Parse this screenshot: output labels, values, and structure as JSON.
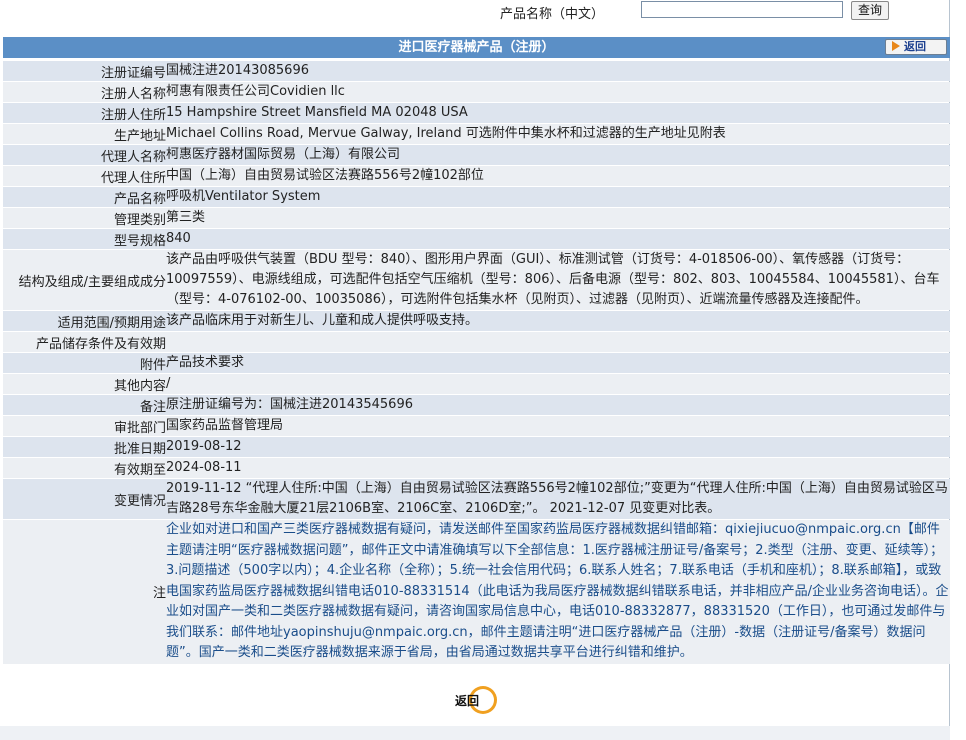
{
  "search": {
    "label": "产品名称（中文）",
    "value": "",
    "button": "查询"
  },
  "header": {
    "title": "进口医疗器械产品（注册）",
    "back_label": "返回"
  },
  "rows": [
    {
      "label": "注册证编号",
      "value": "国械注进20143085696"
    },
    {
      "label": "注册人名称",
      "value": "柯惠有限责任公司Covidien llc"
    },
    {
      "label": "注册人住所",
      "value": "15 Hampshire Street Mansfield MA 02048 USA"
    },
    {
      "label": "生产地址",
      "value": "Michael Collins Road, Mervue Galway, Ireland 可选附件中集水杯和过滤器的生产地址见附表"
    },
    {
      "label": "代理人名称",
      "value": "柯惠医疗器材国际贸易（上海）有限公司"
    },
    {
      "label": "代理人住所",
      "value": "中国（上海）自由贸易试验区法赛路556号2幢102部位"
    },
    {
      "label": "产品名称",
      "value": "呼吸机Ventilator System"
    },
    {
      "label": "管理类别",
      "value": "第三类"
    },
    {
      "label": "型号规格",
      "value": "840"
    },
    {
      "label": "结构及组成/主要组成成分",
      "value": "该产品由呼吸供气装置（BDU 型号：840）、图形用户界面（GUI）、标准测试管（订货号：4-018506-00）、氧传感器（订货号：10097559）、电源线组成，可选配件包括空气压缩机（型号：806）、后备电源（型号：802、803、10045584、10045581）、台车（型号：4-076102-00、10035086），可选附件包括集水杯（见附页）、过滤器（见附页）、近端流量传感器及连接配件。"
    },
    {
      "label": "适用范围/预期用途",
      "value": "该产品临床用于对新生儿、儿童和成人提供呼吸支持。"
    },
    {
      "label": "产品储存条件及有效期",
      "value": ""
    },
    {
      "label": "附件",
      "value": "产品技术要求"
    },
    {
      "label": "其他内容",
      "value": "/"
    },
    {
      "label": "备注",
      "value": "原注册证编号为：国械注进20143545696"
    },
    {
      "label": "审批部门",
      "value": "国家药品监督管理局"
    },
    {
      "label": "批准日期",
      "value": "2019-08-12"
    },
    {
      "label": "有效期至",
      "value": "2024-08-11"
    },
    {
      "label": "变更情况",
      "value": "2019-11-12 “代理人住所:中国（上海）自由贸易试验区法赛路556号2幢102部位;”变更为“代理人住所:中国（上海）自由贸易试验区马吉路28号东华金融大厦21层2106B室、2106C室、2106D室;”。 2021-12-07 见变更对比表。"
    },
    {
      "label": "注",
      "value": "企业如对进口和国产三类医疗器械数据有疑问，请发送邮件至国家药监局医疗器械数据纠错邮箱：qixiejiucuo@nmpaic.org.cn【邮件主题请注明“医疗器械数据问题”，邮件正文中请准确填写以下全部信息：1.医疗器械注册证号/备案号；2.类型（注册、变更、延续等）；3.问题描述（500字以内）；4.企业名称（全称）；5.统一社会信用代码；6.联系人姓名；7.联系电话（手机和座机）；8.联系邮箱】，或致电国家药监局医疗器械数据纠错电话010-88331514（此电话为我局医疗器械数据纠错联系电话，并非相应产品/企业业务咨询电话）。企业如对国产一类和二类医疗器械数据有疑问，请咨询国家局信息中心，电话010-88332877，88331520（工作日），也可通过发邮件与我们联系：邮件地址yaopinshuju@nmpaic.org.cn，邮件主题请注明“进口医疗器械产品（注册）-数据（注册证号/备案号）数据问题”。国产一类和二类医疗器械数据来源于省局，由省局通过数据共享平台进行纠错和维护。"
    }
  ],
  "footer": {
    "back_label": "返回"
  }
}
